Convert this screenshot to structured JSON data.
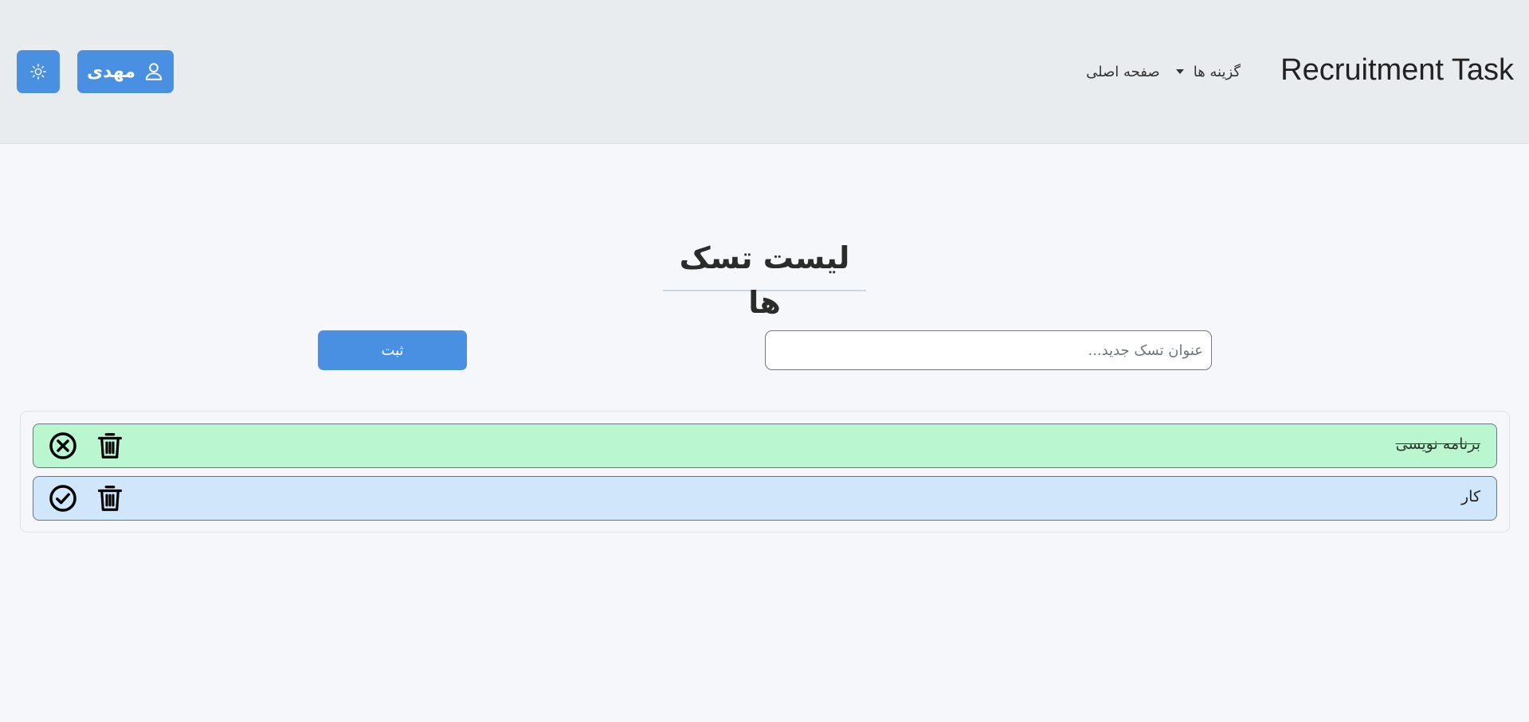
{
  "header": {
    "brand": "Recruitment Task",
    "nav": {
      "home_label": "صفحه اصلی",
      "options_label": "گزینه ها"
    },
    "user_button_label": "مهدی",
    "accent_color": "#4a90e2"
  },
  "main": {
    "title": "لیست تسک ها",
    "new_task_placeholder": "عنوان تسک جدید...",
    "new_task_value": "",
    "submit_label": "ثبت"
  },
  "tasks": [
    {
      "title": "برنامه نویسی",
      "completed": true,
      "status_icon": "x-circle-icon",
      "delete_icon": "trash-icon",
      "bg_color": "#baf7d0"
    },
    {
      "title": "کار",
      "completed": false,
      "status_icon": "check-circle-icon",
      "delete_icon": "trash-icon",
      "bg_color": "#cfe6fb"
    }
  ]
}
